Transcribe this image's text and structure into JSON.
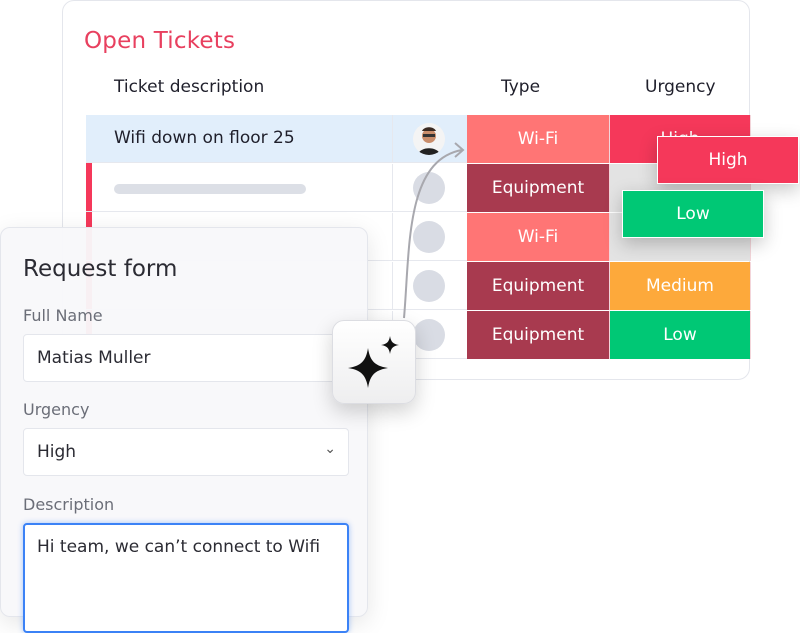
{
  "board": {
    "title": "Open Tickets",
    "columns": {
      "description": "Ticket description",
      "type": "Type",
      "urgency": "Urgency"
    },
    "rows": [
      {
        "description": "Wifi down on floor 25",
        "owner": "photo-avatar",
        "type": "Wi-Fi",
        "type_color": "#ff7575",
        "urgency": "High",
        "urgency_color": "#f5385a",
        "selected": true
      },
      {
        "description": "",
        "owner": "empty-avatar",
        "type": "Equipment",
        "type_color": "#a83a4f",
        "urgency": "",
        "urgency_color": "#e3e3e3",
        "selected": false
      },
      {
        "description": "",
        "owner": "empty-avatar",
        "type": "Wi-Fi",
        "type_color": "#ff7575",
        "urgency": "",
        "urgency_color": "#e3e3e3",
        "selected": false
      },
      {
        "description": "",
        "owner": "empty-avatar",
        "type": "Equipment",
        "type_color": "#a83a4f",
        "urgency": "Medium",
        "urgency_color": "#fda93b",
        "selected": false
      },
      {
        "description": "",
        "owner": "empty-avatar",
        "type": "Equipment",
        "type_color": "#a83a4f",
        "urgency": "Low",
        "urgency_color": "#00c875",
        "selected": false
      }
    ],
    "floating_options": [
      {
        "label": "High",
        "color": "#f5385a"
      },
      {
        "label": "Low",
        "color": "#00c875"
      }
    ]
  },
  "form": {
    "title": "Request form",
    "full_name_label": "Full Name",
    "full_name_value": "Matias Muller",
    "urgency_label": "Urgency",
    "urgency_value": "High",
    "description_label": "Description",
    "description_value": "Hi team, we can’t connect to Wifi"
  },
  "ai_button": {
    "icon": "sparkles-icon"
  },
  "colors": {
    "accent": "#e8405f",
    "focus": "#3b82f6"
  }
}
